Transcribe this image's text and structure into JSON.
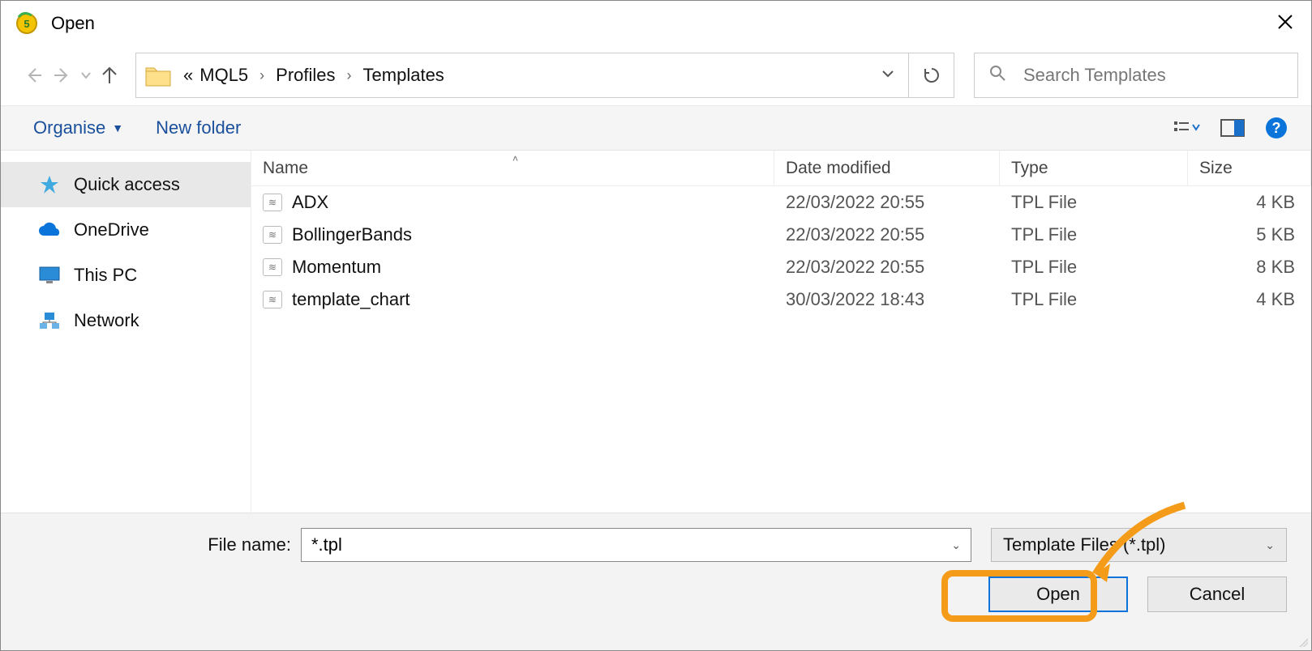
{
  "title": "Open",
  "breadcrumb": {
    "overflow": "«",
    "items": [
      "MQL5",
      "Profiles",
      "Templates"
    ]
  },
  "search": {
    "placeholder": "Search Templates"
  },
  "toolbar": {
    "organise": "Organise",
    "newfolder": "New folder"
  },
  "sidebar": {
    "items": [
      {
        "label": "Quick access",
        "icon": "star"
      },
      {
        "label": "OneDrive",
        "icon": "cloud"
      },
      {
        "label": "This PC",
        "icon": "monitor"
      },
      {
        "label": "Network",
        "icon": "network"
      }
    ]
  },
  "columns": {
    "name": "Name",
    "date": "Date modified",
    "type": "Type",
    "size": "Size"
  },
  "files": [
    {
      "name": "ADX",
      "date": "22/03/2022 20:55",
      "type": "TPL File",
      "size": "4 KB"
    },
    {
      "name": "BollingerBands",
      "date": "22/03/2022 20:55",
      "type": "TPL File",
      "size": "5 KB"
    },
    {
      "name": "Momentum",
      "date": "22/03/2022 20:55",
      "type": "TPL File",
      "size": "8 KB"
    },
    {
      "name": "template_chart",
      "date": "30/03/2022 18:43",
      "type": "TPL File",
      "size": "4 KB"
    }
  ],
  "filename": {
    "label": "File name:",
    "value": "*.tpl"
  },
  "filetype": {
    "label": "Template Files (*.tpl)"
  },
  "buttons": {
    "open": "Open",
    "cancel": "Cancel"
  }
}
